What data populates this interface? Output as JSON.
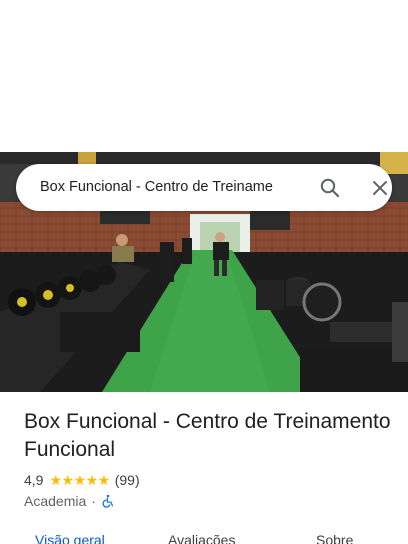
{
  "search": {
    "query": "Box Funcional - Centro de Treiname"
  },
  "place": {
    "title": "Box Funcional - Centro de Treinamento Funcional",
    "rating": "4,9",
    "stars": "★★★★★",
    "review_count": "(99)",
    "category": "Academia",
    "separator": "·"
  },
  "tabs": [
    {
      "label": "Visão geral",
      "active": true
    },
    {
      "label": "Avaliações",
      "active": false
    },
    {
      "label": "Sobre",
      "active": false
    }
  ],
  "colors": {
    "accent": "#0b57d0",
    "star": "#fbbc04",
    "turf": "#3fa34a"
  }
}
